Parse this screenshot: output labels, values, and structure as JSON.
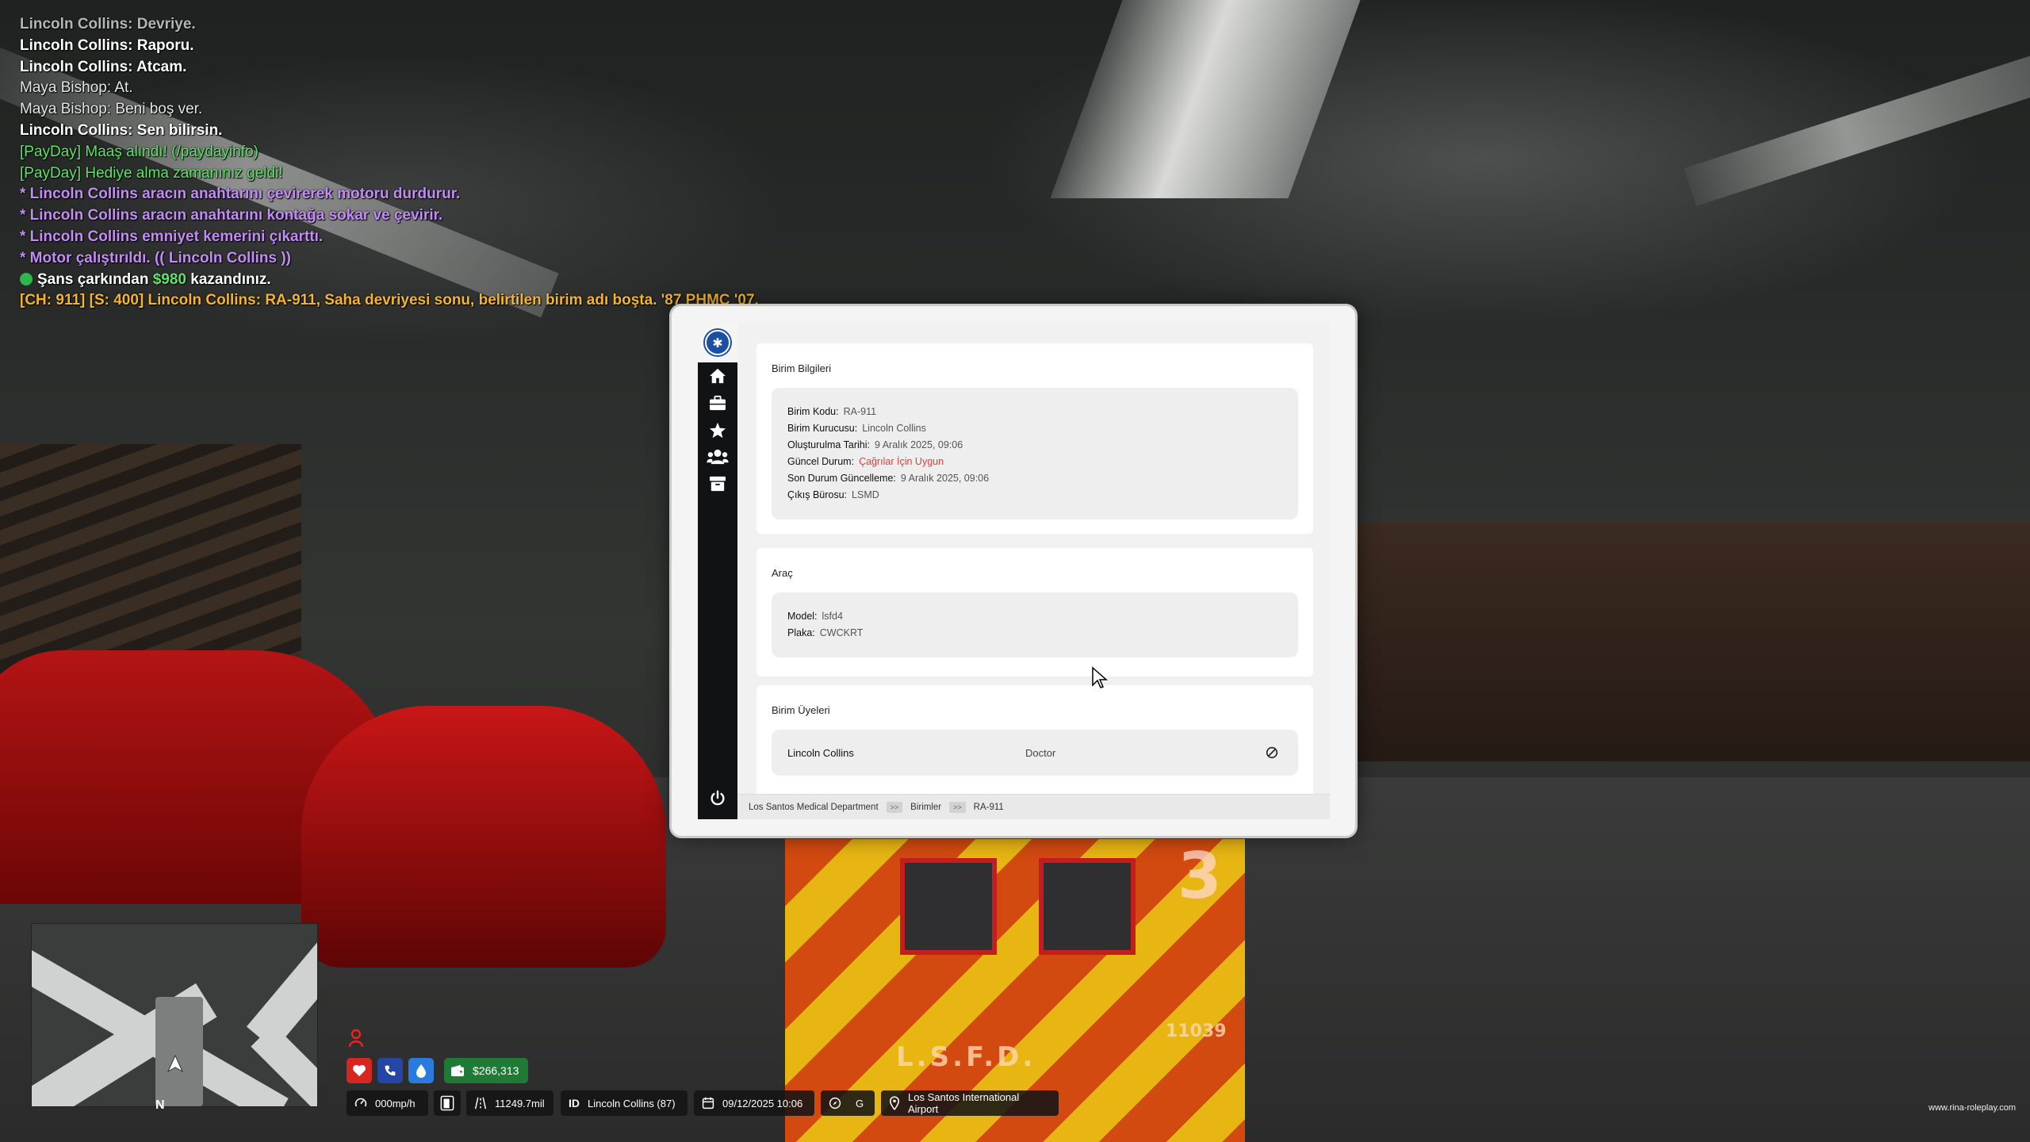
{
  "chat": [
    {
      "text": "Lincoln Collins: Devriye.",
      "style": "dim"
    },
    {
      "text": "Lincoln Collins: Raporu.",
      "style": "white"
    },
    {
      "text": "Lincoln Collins: Atcam.",
      "style": "white"
    },
    {
      "text": "Maya Bishop: At.",
      "style": "grey"
    },
    {
      "text": "Maya Bishop: Beni boş ver.",
      "style": "grey"
    },
    {
      "text": "Lincoln Collins: Sen bilirsin.",
      "style": "white"
    },
    {
      "text": "[PayDay] Maaş alındı! (/paydayinfo)",
      "style": "green"
    },
    {
      "text": "[PayDay] Hediye alma zamanınız geldi!",
      "style": "green"
    },
    {
      "text": "* Lincoln Collins aracın anahtarını çevirerek motoru durdurur.",
      "style": "purple"
    },
    {
      "text": "* Lincoln Collins aracın anahtarını kontağa sokar ve çevirir.",
      "style": "purple"
    },
    {
      "text": "* Lincoln Collins emniyet kemerini çıkarttı.",
      "style": "purple"
    },
    {
      "text": "* Motor çalıştırıldı. (( Lincoln Collins ))",
      "style": "purple"
    },
    {
      "text": "[CH: 911] [S: 400] Lincoln Collins: RA-911, Saha devriyesi sonu, belirtilen birim adı boşta. '87 PHMC '07.",
      "style": "orange"
    }
  ],
  "chance": {
    "prefix": "Şans çarkından",
    "amount": "$980",
    "suffix": "kazandınız."
  },
  "tablet": {
    "unit_card": {
      "title": "Birim Bilgileri",
      "rows": [
        {
          "key": "Birim Kodu:",
          "value": "RA-911"
        },
        {
          "key": "Birim Kurucusu:",
          "value": "Lincoln Collins"
        },
        {
          "key": "Oluşturulma Tarihi:",
          "value": "9 Aralık 2025, 09:06"
        },
        {
          "key": "Güncel Durum:",
          "value": "Çağrılar İçin Uygun"
        },
        {
          "key": "Son Durum Güncelleme:",
          "value": "9 Aralık 2025, 09:06"
        },
        {
          "key": "Çıkış Bürosu:",
          "value": "LSMD"
        }
      ]
    },
    "vehicle_card": {
      "title": "Araç",
      "rows": [
        {
          "key": "Model:",
          "value": "lsfd4"
        },
        {
          "key": "Plaka:",
          "value": "CWCKRT"
        }
      ]
    },
    "members_card": {
      "title": "Birim Üyeleri",
      "members": [
        {
          "name": "Lincoln Collins",
          "role": "Doctor"
        }
      ]
    },
    "breadcrumb": [
      "Los Santos Medical Department",
      "Birimler",
      "RA-911"
    ],
    "breadcrumb_sep": ">>",
    "nav_icons": [
      "home-icon",
      "briefcase-icon",
      "star-icon",
      "users-icon",
      "archive-icon"
    ],
    "status_color": "#e23c3c"
  },
  "hud": {
    "money": "$266,313",
    "speed": "000mp/h",
    "odometer": "11249.7mil",
    "player": "Lincoln Collins (87)",
    "datetime": "09/12/2025 10:06",
    "gear": "G",
    "location": "Los Santos International Airport",
    "compass": "N",
    "watermark": "www.rina-roleplay.com",
    "id_label": "ID"
  },
  "ambulance": {
    "label": "L.S.F.D.",
    "number": "3",
    "id": "11039"
  }
}
